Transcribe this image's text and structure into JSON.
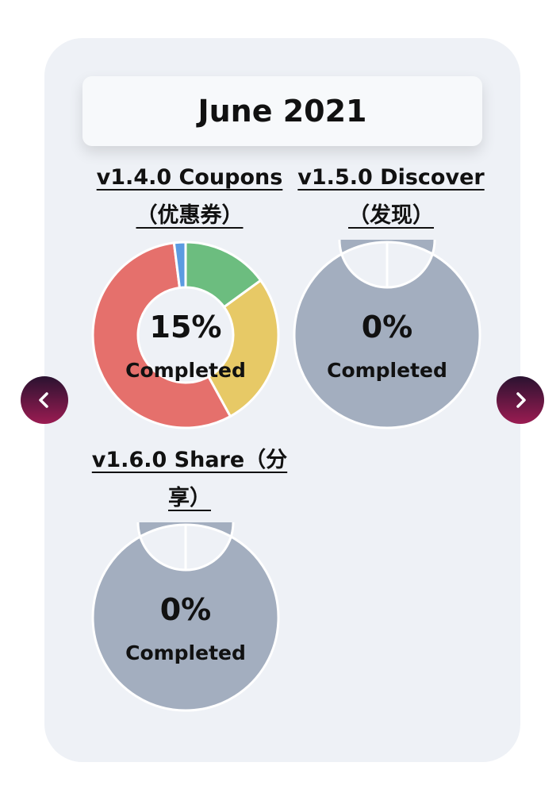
{
  "header": {
    "title": "June 2021"
  },
  "nav": {
    "prev_icon": "chevron-left-icon",
    "next_icon": "chevron-right-icon"
  },
  "items": [
    {
      "title": "v1.4.0 Coupons（优惠券）",
      "percent": "15%",
      "status": "Completed",
      "segments": [
        {
          "value": 15,
          "color": "#6cbd7f"
        },
        {
          "value": 27,
          "color": "#e7c966"
        },
        {
          "value": 56,
          "color": "#e5706c"
        },
        {
          "value": 2,
          "color": "#5b9be1"
        }
      ]
    },
    {
      "title": "v1.5.0 Discover（发现）",
      "percent": "0%",
      "status": "Completed",
      "segments": [
        {
          "value": 100,
          "color": "#a3aebf"
        }
      ]
    },
    {
      "title": "v1.6.0 Share（分享）",
      "percent": "0%",
      "status": "Completed",
      "segments": [
        {
          "value": 100,
          "color": "#a3aebf"
        }
      ]
    }
  ]
}
